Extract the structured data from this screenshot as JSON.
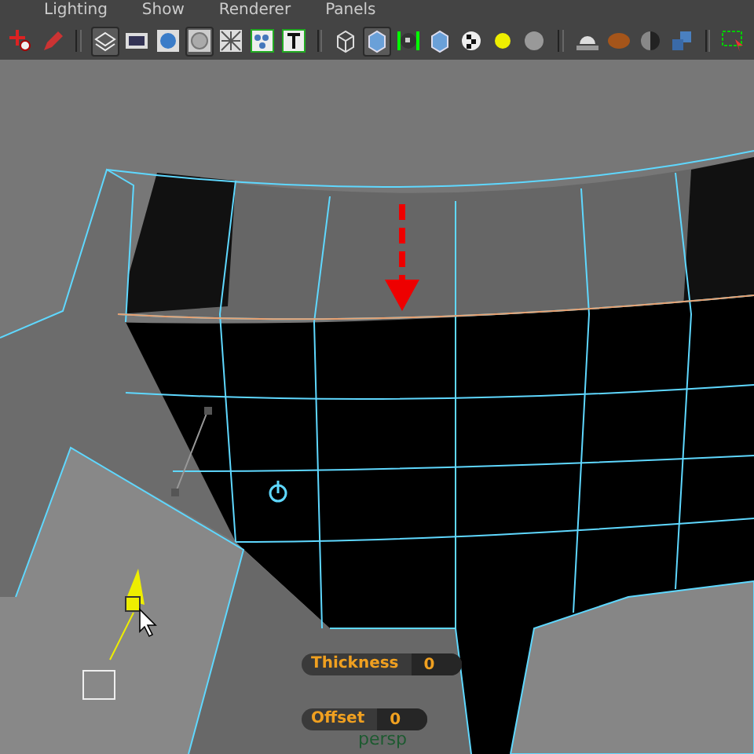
{
  "menu": [
    "Lighting",
    "Show",
    "Renderer",
    "Panels"
  ],
  "toolbar": [
    [
      {
        "kind": "move",
        "selected": false
      },
      {
        "kind": "pencil",
        "selected": false
      }
    ],
    [
      {
        "kind": "layers",
        "selected": true
      },
      {
        "kind": "film",
        "selected": false
      },
      {
        "kind": "sphere",
        "selected": false
      },
      {
        "kind": "circle",
        "selected": true
      },
      {
        "kind": "grid",
        "selected": false
      },
      {
        "kind": "dots",
        "selected": false
      },
      {
        "kind": "text",
        "selected": false
      }
    ],
    [
      {
        "kind": "wirecube",
        "selected": false
      },
      {
        "kind": "cube",
        "selected": true
      },
      {
        "kind": "checkercube",
        "selected": false
      },
      {
        "kind": "cube",
        "selected": false
      },
      {
        "kind": "checkerball",
        "selected": false
      },
      {
        "kind": "light",
        "selected": false
      },
      {
        "kind": "grayball",
        "selected": false
      }
    ],
    [
      {
        "kind": "dome",
        "selected": false
      },
      {
        "kind": "woodball",
        "selected": false
      },
      {
        "kind": "halfball",
        "selected": false
      },
      {
        "kind": "cubes",
        "selected": false
      }
    ],
    [
      {
        "kind": "select",
        "selected": false
      }
    ]
  ],
  "viewport": {
    "camera": "persp",
    "fields": [
      {
        "label": "Thickness",
        "value": "0"
      },
      {
        "label": "Offset",
        "value": "0"
      }
    ]
  }
}
